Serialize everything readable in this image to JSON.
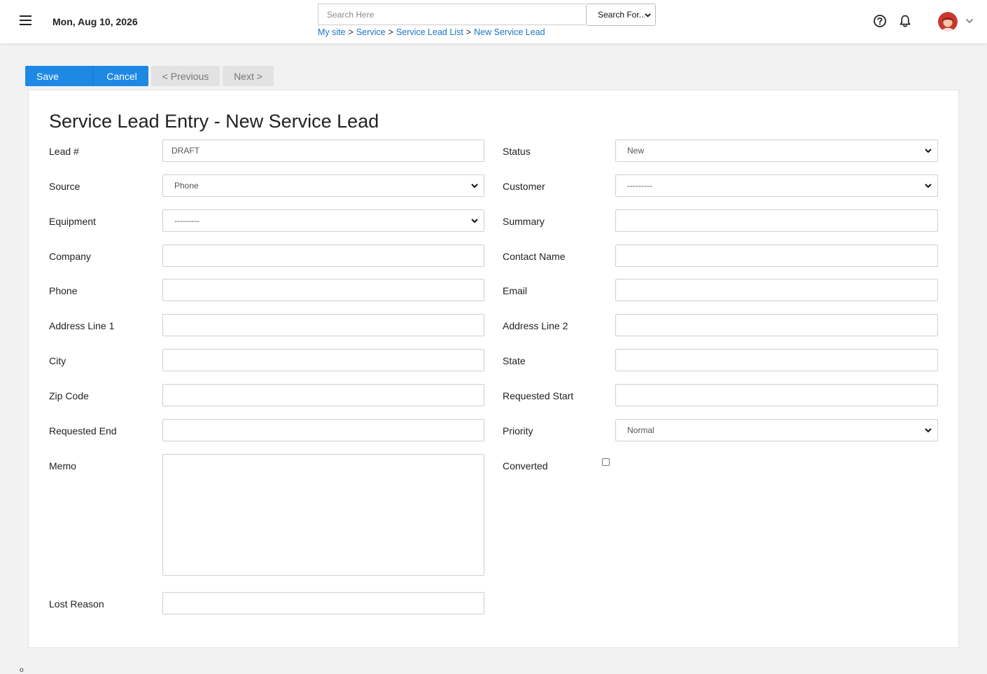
{
  "header": {
    "date": "Mon, Aug 10, 2026",
    "search": {
      "placeholder": "Search Here",
      "value": ""
    },
    "search_scope": "Search For...",
    "breadcrumb": [
      "My site",
      "Service",
      "Service Lead List",
      "New Service Lead"
    ],
    "breadcrumb_sep": ">",
    "icons": [
      "menu-icon",
      "help-icon",
      "bell-icon",
      "chevron-down-icon"
    ]
  },
  "toolbar": {
    "save_label": "Save",
    "cancel_label": "Cancel",
    "previous_label": "< Previous",
    "next_label": "Next >"
  },
  "form": {
    "title": "Service Lead Entry - New Service Lead",
    "fields": {
      "lead_no": {
        "label": "Lead #",
        "value": "DRAFT"
      },
      "status": {
        "label": "Status",
        "value": "New"
      },
      "source": {
        "label": "Source",
        "value": "Phone"
      },
      "customer": {
        "label": "Customer",
        "value": "---------"
      },
      "equipment": {
        "label": "Equipment",
        "value": "---------"
      },
      "summary": {
        "label": "Summary",
        "value": ""
      },
      "company": {
        "label": "Company",
        "value": ""
      },
      "contact_name": {
        "label": "Contact Name",
        "value": ""
      },
      "phone": {
        "label": "Phone",
        "value": ""
      },
      "email": {
        "label": "Email",
        "value": ""
      },
      "address1": {
        "label": "Address Line 1",
        "value": ""
      },
      "address2": {
        "label": "Address Line 2",
        "value": ""
      },
      "city": {
        "label": "City",
        "value": ""
      },
      "state": {
        "label": "State",
        "value": ""
      },
      "zip": {
        "label": "Zip Code",
        "value": ""
      },
      "requested_start": {
        "label": "Requested Start",
        "value": ""
      },
      "requested_end": {
        "label": "Requested End",
        "value": ""
      },
      "priority": {
        "label": "Priority",
        "value": "Normal"
      },
      "memo": {
        "label": "Memo",
        "value": ""
      },
      "converted": {
        "label": "Converted",
        "checked": false
      },
      "lost_reason": {
        "label": "Lost Reason",
        "value": ""
      }
    }
  },
  "colors": {
    "primary": "#1e88e5",
    "link": "#1a73c8",
    "background": "#f2f2f2"
  },
  "footer": {
    "glyph": "o"
  }
}
